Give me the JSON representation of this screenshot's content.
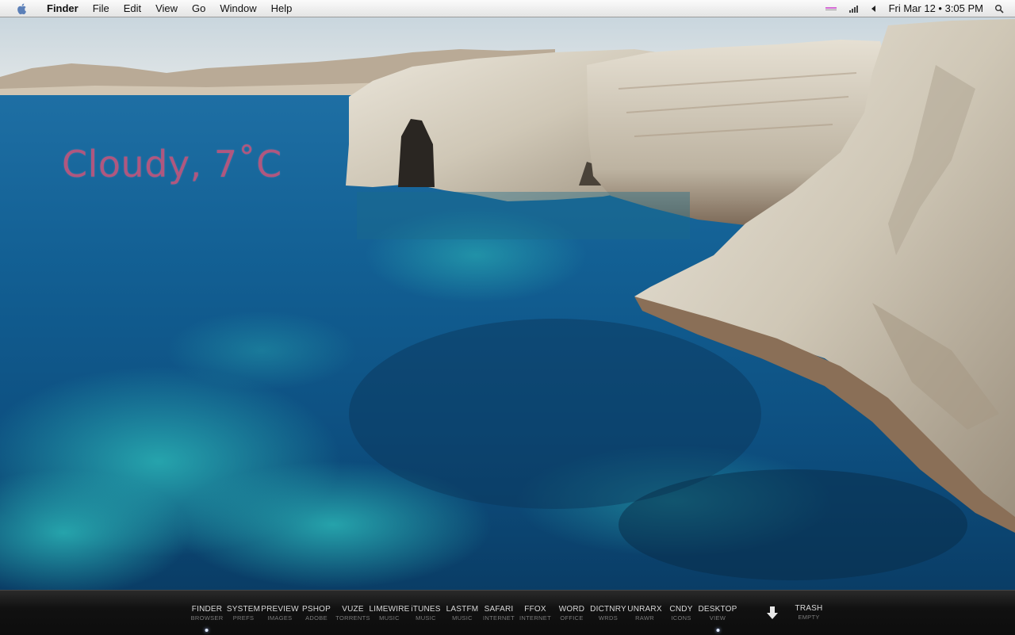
{
  "menubar": {
    "app_name": "Finder",
    "items": [
      "File",
      "Edit",
      "View",
      "Go",
      "Window",
      "Help"
    ],
    "clock": "Fri Mar 12 • 3:05 PM",
    "status_icons": [
      "battery-icon",
      "signal-icon",
      "volume-icon",
      "search-icon"
    ]
  },
  "desktop": {
    "weather_text": "Cloudy, 7˚C"
  },
  "dock": {
    "items": [
      {
        "label": "FINDER",
        "sub": "BROWSER",
        "running": true
      },
      {
        "label": "SYSTEM",
        "sub": "PREFS",
        "running": false
      },
      {
        "label": "PREVIEW",
        "sub": "IMAGES",
        "running": false
      },
      {
        "label": "PSHOP",
        "sub": "ADOBE",
        "running": false
      },
      {
        "label": "VUZE",
        "sub": "TORRENTS",
        "running": false
      },
      {
        "label": "LIMEWIRE",
        "sub": "MUSIC",
        "running": false
      },
      {
        "label": "iTUNES",
        "sub": "MUSIC",
        "running": false
      },
      {
        "label": "LASTFM",
        "sub": "MUSIC",
        "running": false
      },
      {
        "label": "SAFARI",
        "sub": "INTERNET",
        "running": false
      },
      {
        "label": "FFOX",
        "sub": "INTERNET",
        "running": false
      },
      {
        "label": "WORD",
        "sub": "OFFICE",
        "running": false
      },
      {
        "label": "DICTNRY",
        "sub": "WRDS",
        "running": false
      },
      {
        "label": "UNRARX",
        "sub": "RAWR",
        "running": false
      },
      {
        "label": "CNDY",
        "sub": "ICONS",
        "running": false
      },
      {
        "label": "DESKTOP",
        "sub": "VIEW",
        "running": true
      }
    ],
    "downloads_icon": "down-arrow-icon",
    "trash": {
      "label": "TRASH",
      "sub": "EMPTY"
    }
  },
  "colors": {
    "weather_text": "#b0577f",
    "dock_background": "#111111",
    "menubar_background": "#f0f0f0"
  }
}
